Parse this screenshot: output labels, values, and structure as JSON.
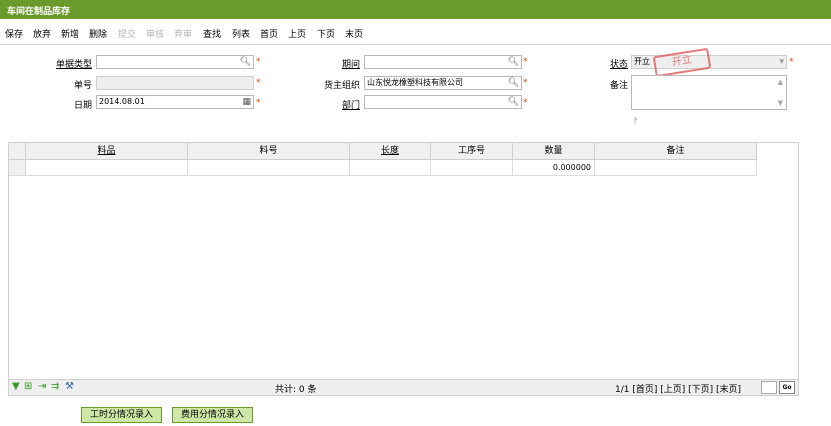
{
  "title": "车间在制品库存",
  "toolbar": {
    "items": [
      {
        "label": "保存",
        "enabled": true
      },
      {
        "label": "放弃",
        "enabled": true
      },
      {
        "label": "新增",
        "enabled": true
      },
      {
        "label": "删除",
        "enabled": true
      },
      {
        "label": "提交",
        "enabled": false
      },
      {
        "label": "审核",
        "enabled": false
      },
      {
        "label": "弃审",
        "enabled": false
      },
      {
        "label": "查找",
        "enabled": true
      },
      {
        "label": "列表",
        "enabled": true
      },
      {
        "label": "首页",
        "enabled": true
      },
      {
        "label": "上页",
        "enabled": true
      },
      {
        "label": "下页",
        "enabled": true
      },
      {
        "label": "末页",
        "enabled": true
      }
    ]
  },
  "form": {
    "doc_type": {
      "label": "单据类型",
      "value": ""
    },
    "doc_no": {
      "label": "单号",
      "value": ""
    },
    "date": {
      "label": "日期",
      "value": "2014.08.01"
    },
    "period": {
      "label": "期间",
      "value": ""
    },
    "owner_org": {
      "label": "货主组织",
      "value": "山东悦龙橡塑科技有限公司"
    },
    "department": {
      "label": "部门",
      "value": ""
    },
    "status": {
      "label": "状态",
      "value": "开立",
      "stamp": "开立"
    },
    "remark": {
      "label": "备注",
      "value": ""
    }
  },
  "grid": {
    "columns": [
      "料品",
      "料号",
      "长度",
      "工序号",
      "数量",
      "备注"
    ],
    "rows": [
      {
        "item": "",
        "item_no": "",
        "length": "",
        "op_no": "",
        "qty": "0.000000",
        "remark": ""
      }
    ],
    "total": "共计: 0 条",
    "pager": "1/1 [首页] [上页] [下页] [末页]",
    "go_label": "Go"
  },
  "buttons": {
    "labor": "工时分情况录入",
    "expense": "费用分情况录入"
  },
  "colors": {
    "title_bar": "#6a9a2a",
    "button_bg": "#cfe7a6",
    "required": "#e04a00",
    "stamp": "#e05050"
  }
}
